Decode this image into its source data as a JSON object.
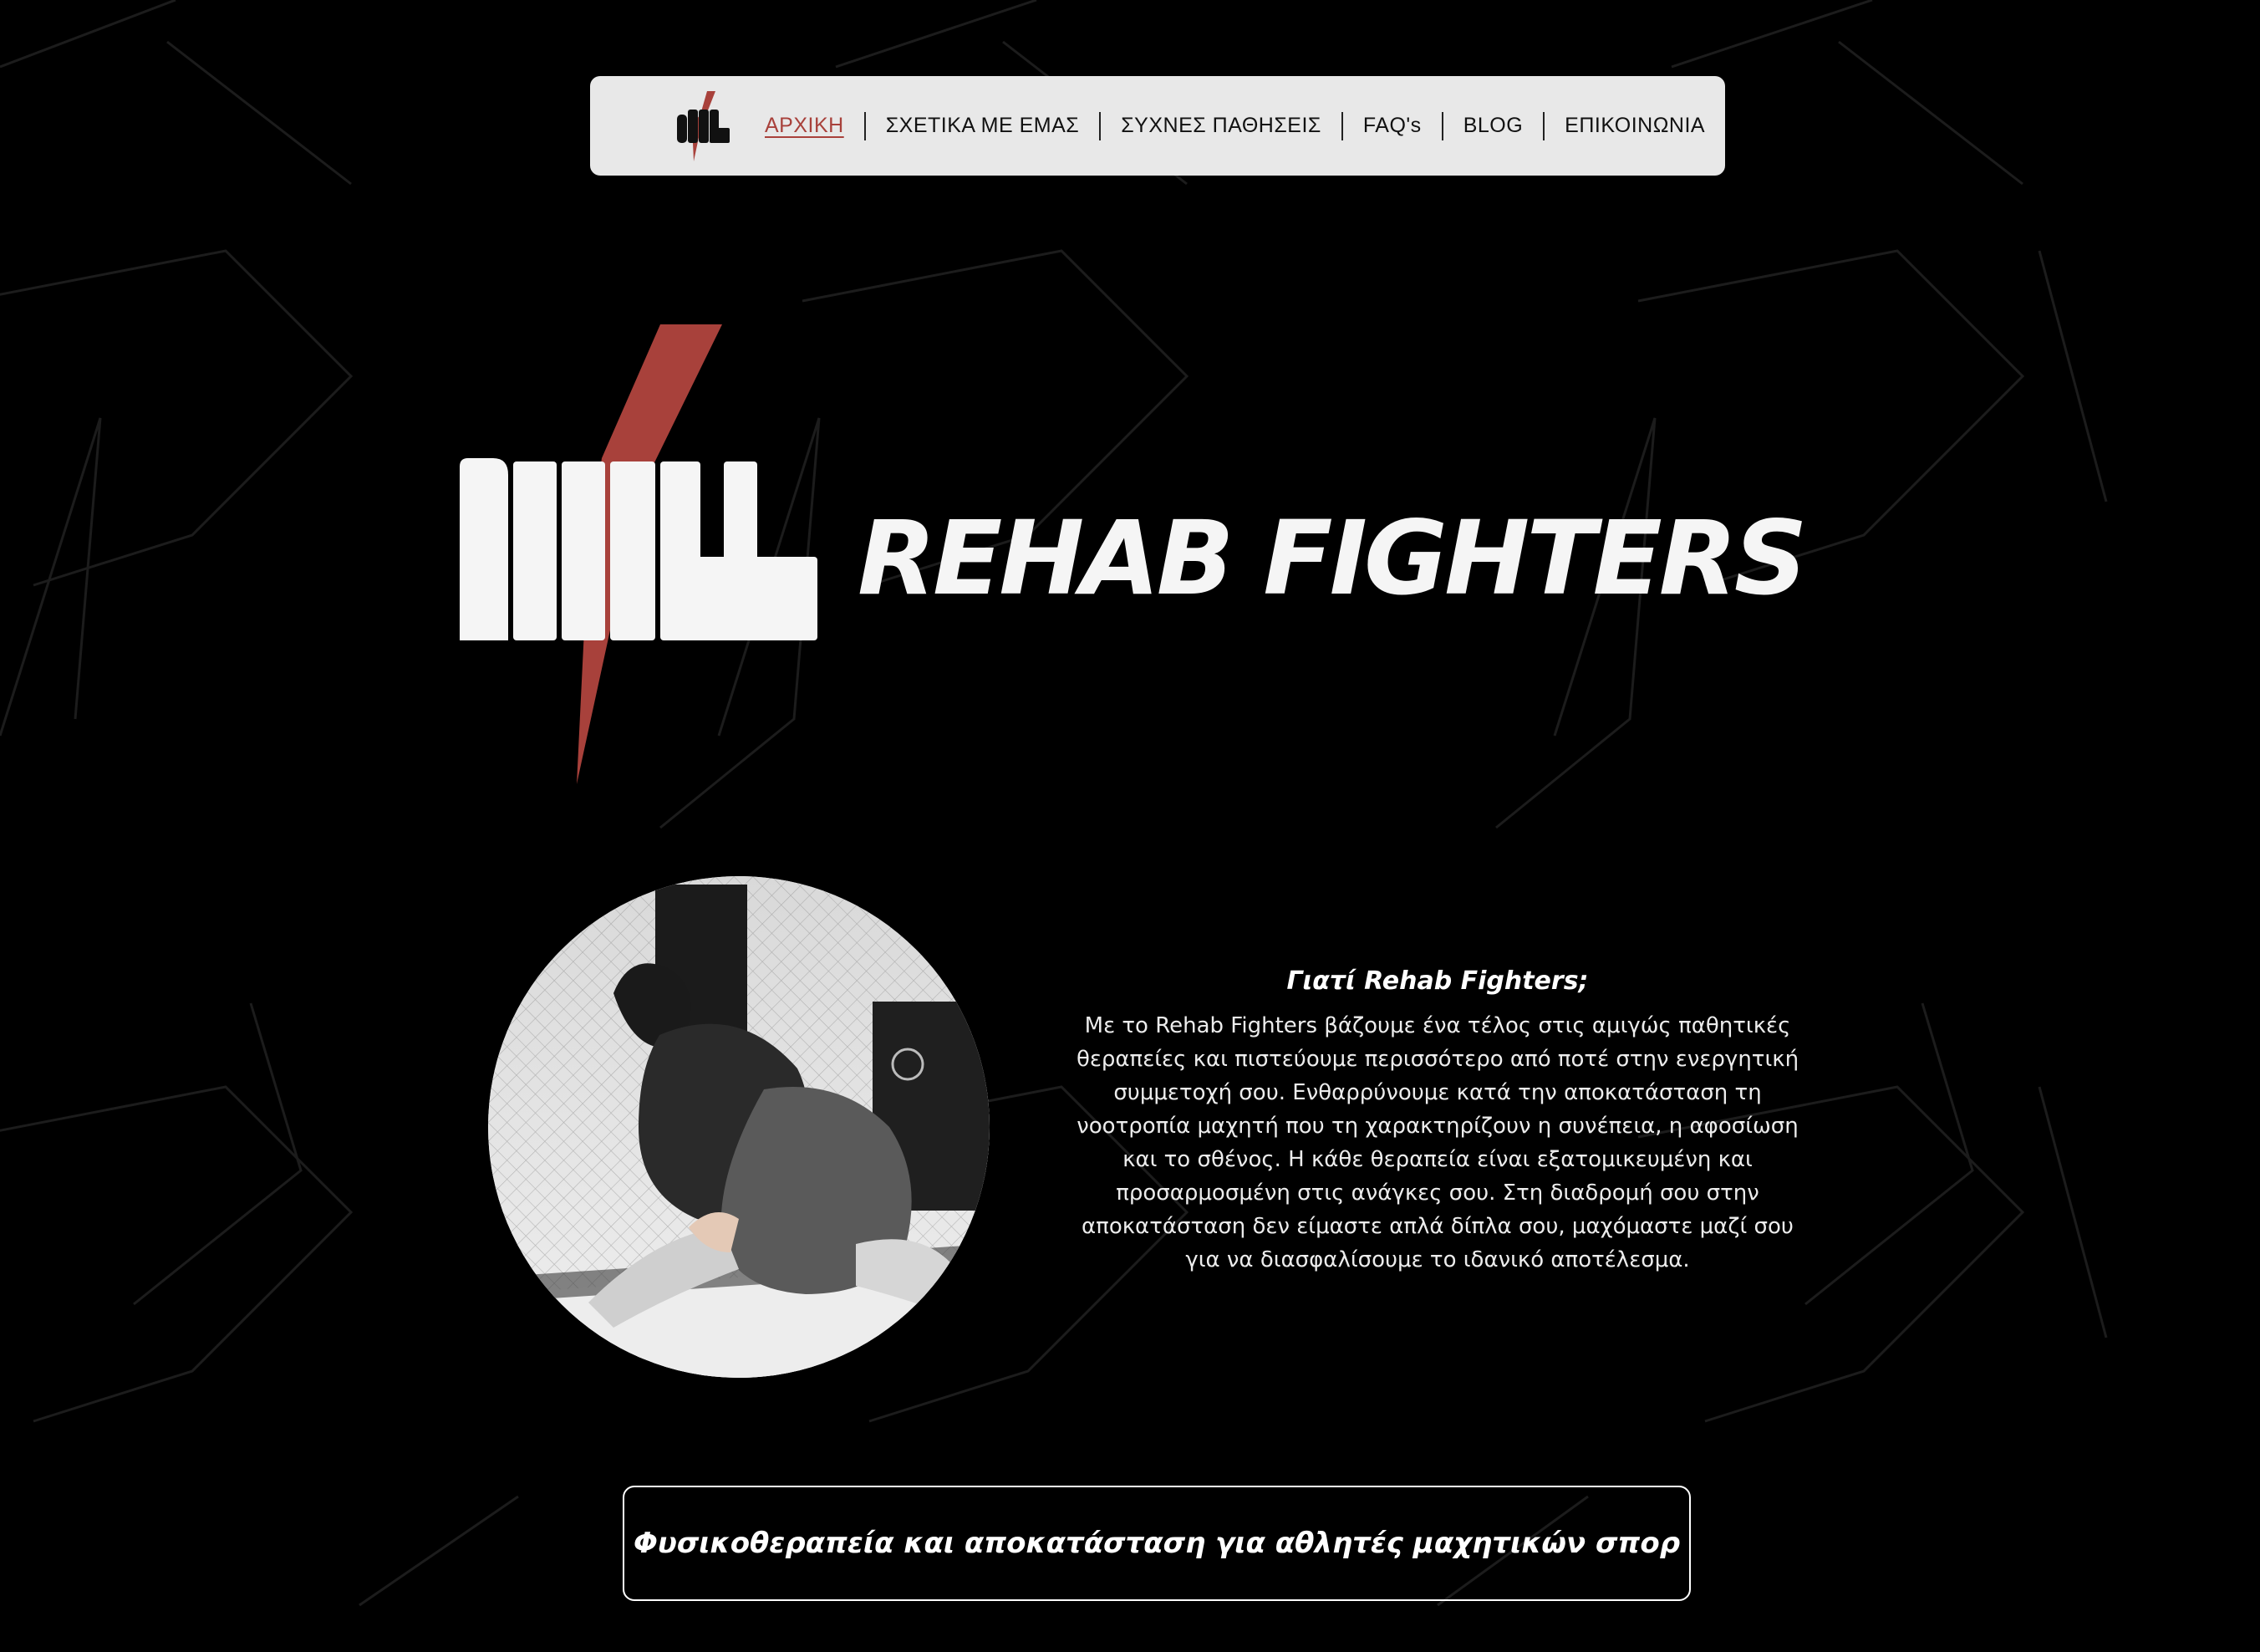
{
  "colors": {
    "background": "#000000",
    "nav_background": "#e8e8e8",
    "accent_red": "#a8413b",
    "text_light": "#ececec"
  },
  "nav": {
    "logo_icon": "fist-lightning-logo-icon",
    "items": [
      {
        "label": "ΑΡΧΙΚΗ",
        "active": true
      },
      {
        "label": "ΣΧΕΤΙΚΑ ΜΕ ΕΜΑΣ",
        "active": false
      },
      {
        "label": "ΣΥΧΝΕΣ ΠΑΘΗΣΕΙΣ",
        "active": false
      },
      {
        "label": "FAQ's",
        "active": false
      },
      {
        "label": "BLOG",
        "active": false
      },
      {
        "label": "ΕΠΙΚΟΙΝΩΝΙΑ",
        "active": false
      }
    ]
  },
  "hero": {
    "brand_name": "REHAB FIGHTERS",
    "logo_icon": "fist-lightning-logo-icon"
  },
  "why": {
    "heading": "Γιατί Rehab Fighters;",
    "body_lines": [
      "Με το Rehab Fighters βάζουμε ένα τέλος στις αμιγώς παθητικές",
      "θεραπείες και πιστεύουμε περισσότερο από ποτέ στην ενεργητική",
      "συμμετοχή σου. Ενθαρρύνουμε κατά την αποκατάσταση τη",
      "νοοτροπία μαχητή που τη χαρακτηρίζουν η συνέπεια, η αφοσίωση",
      "και το σθένος. Η κάθε θεραπεία είναι εξατομικευμένη και",
      "προσαρμοσμένη στις ανάγκες σου. Στη διαδρομή σου στην",
      "αποκατάσταση δεν είμαστε απλά δίπλα σου, μαχόμαστε μαζί σου",
      "για να διασφαλίσουμε το ιδανικό αποτέλεσμα."
    ],
    "photo": "grappling-training-photo"
  },
  "tagline": {
    "text": "Φυσικοθεραπεία και αποκατάσταση για αθλητές μαχητικών σπορ"
  }
}
